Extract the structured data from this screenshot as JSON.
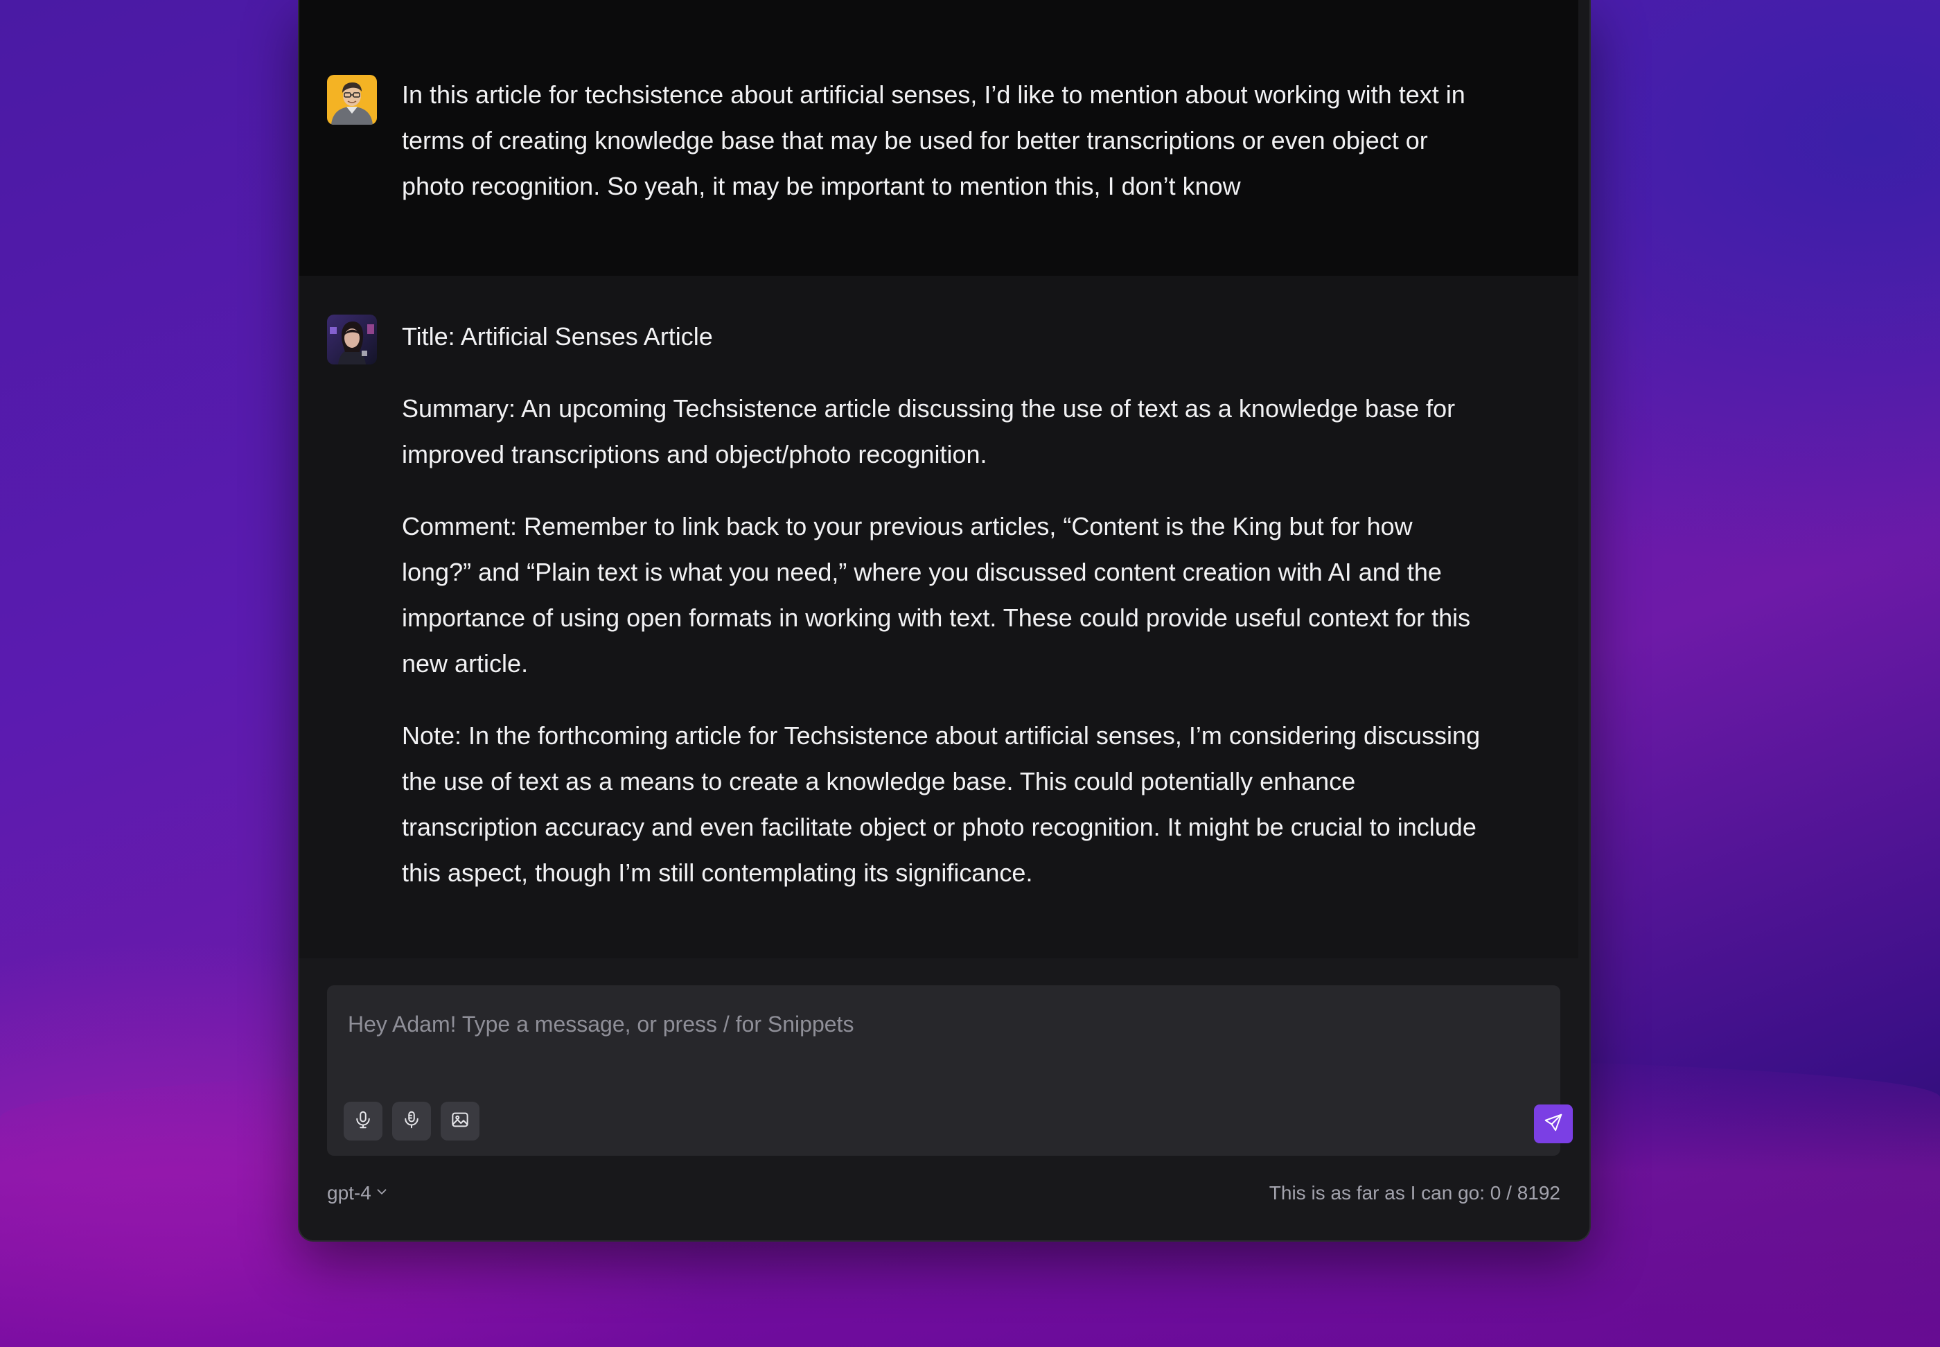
{
  "conversation": {
    "user_message": "In this article for techsistence about artificial senses, I’d like to mention about working with text in terms of creating knowledge base that may be used for better transcriptions or even object or photo recognition. So yeah, it may be important to mention this, I don’t know",
    "ai_response": {
      "title": "Title: Artificial Senses Article",
      "summary": "Summary: An upcoming Techsistence article discussing the use of text as a knowledge base for improved transcriptions and object/photo recognition.",
      "comment": "Comment: Remember to link back to your previous articles, “Content is the King but for how long?” and “Plain text is what you need,” where you discussed content creation with AI and the importance of using open formats in working with text. These could provide useful context for this new article.",
      "note": "Note: In the forthcoming article for Techsistence about artificial senses, I’m considering discussing the use of text as a means to create a knowledge base. This could potentially enhance transcription accuracy and even facilitate object or photo recognition. It might be crucial to include this aspect, though I’m still contemplating its significance."
    }
  },
  "composer": {
    "placeholder": "Hey Adam! Type a message, or press / for Snippets",
    "value": "",
    "tools": [
      {
        "icon": "microphone-icon"
      },
      {
        "icon": "microphone-alt-icon"
      },
      {
        "icon": "image-icon"
      }
    ],
    "send_icon": "send-icon"
  },
  "footer": {
    "model": "gpt-4",
    "model_icon": "chevron-down-icon",
    "token_limit_text": "This is as far as I can go: 0 / 8192"
  },
  "colors": {
    "accent": "#7b3fe4",
    "window_bg": "#18181b",
    "user_bg": "#0b0b0c",
    "ai_bg": "#141416",
    "composer_bg": "#27272b",
    "user_avatar_bg": "#f4b324"
  }
}
